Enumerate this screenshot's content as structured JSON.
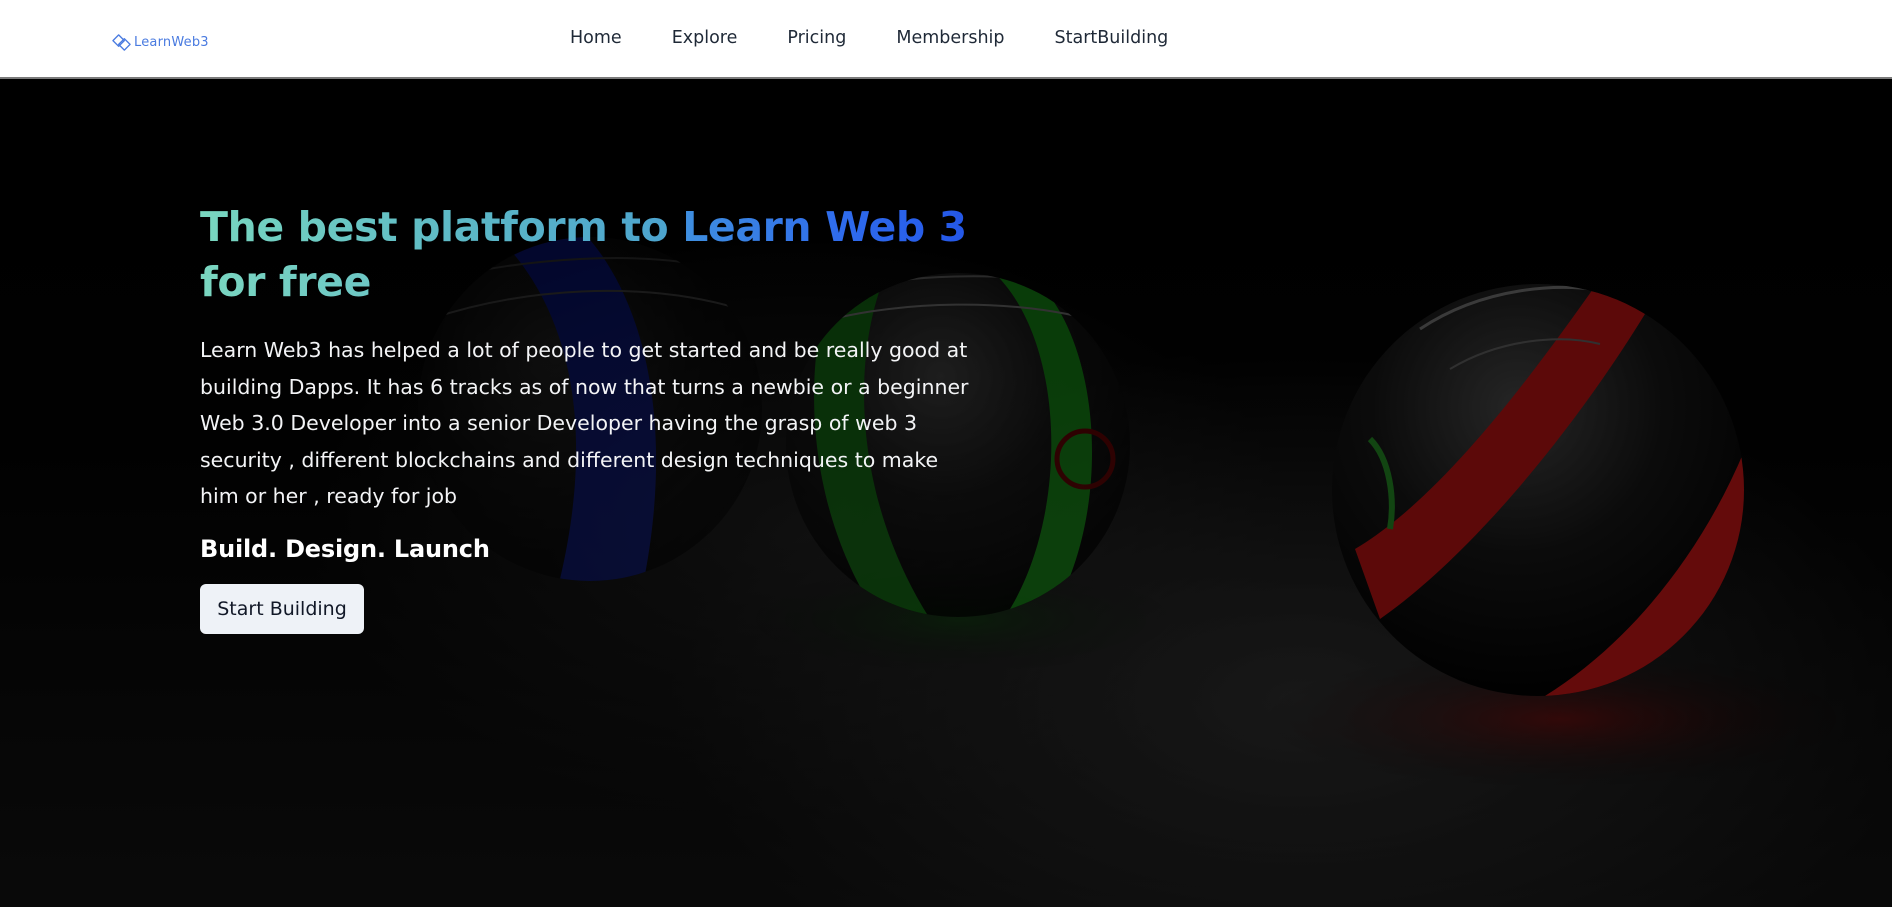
{
  "nav": {
    "logo_text": "LearnWeb3",
    "links": [
      "Home",
      "Explore",
      "Pricing",
      "Membership",
      "StartBuilding"
    ]
  },
  "hero": {
    "title_part1": "The best platform to ",
    "title_part2": "Learn Web 3",
    "title_part3": "for free",
    "description": "Learn Web3 has helped a lot of people to get started and be really good at building Dapps. It has 6 tracks as of now that turns a newbie or a beginner Web 3.0 Developer into a senior Developer having the grasp of web 3 security , different blockchains and different design techniques to make him or her , ready for job",
    "tagline": "Build. Design. Launch",
    "cta_label": "Start Building"
  },
  "colors": {
    "title_gradient_start": "#79d7bf",
    "title_gradient_end": "#2457e8",
    "logo": "#4a7be0",
    "background": "#000000"
  },
  "icons": {
    "logo": "learnweb3-logo-icon"
  }
}
